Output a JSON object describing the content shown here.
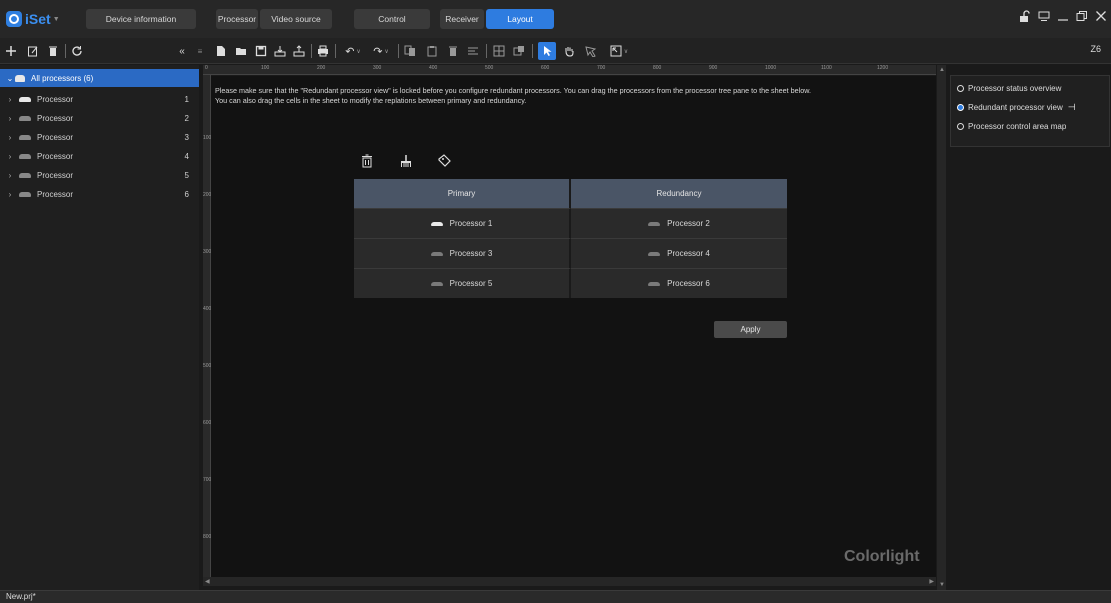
{
  "app": {
    "name": "iSet",
    "tabs": [
      {
        "label": "Device information",
        "active": false
      },
      {
        "label": "Processor",
        "active": false
      },
      {
        "label": "Video source",
        "active": false
      },
      {
        "label": "Control",
        "active": false
      },
      {
        "label": "Receiver",
        "active": false
      },
      {
        "label": "Layout",
        "active": true
      }
    ],
    "window_controls": [
      "unlock-icon",
      "monitor-icon",
      "minimize-icon",
      "restore-icon",
      "close-icon"
    ]
  },
  "toolbar": {
    "zoom": "Z6"
  },
  "tree": {
    "root_label": "All processors (6)",
    "items": [
      {
        "label": "Processor",
        "num": "1",
        "online": true
      },
      {
        "label": "Processor",
        "num": "2",
        "online": false
      },
      {
        "label": "Processor",
        "num": "3",
        "online": false
      },
      {
        "label": "Processor",
        "num": "4",
        "online": false
      },
      {
        "label": "Processor",
        "num": "5",
        "online": false
      },
      {
        "label": "Processor",
        "num": "6",
        "online": false
      }
    ]
  },
  "ruler": {
    "top": [
      "0",
      "100",
      "200",
      "300",
      "400",
      "500",
      "600",
      "700",
      "800",
      "900",
      "1000",
      "1100",
      "1200"
    ],
    "left": [
      "100",
      "200",
      "300",
      "400",
      "500",
      "600",
      "700",
      "800",
      "900"
    ]
  },
  "notice": {
    "line1": "Please make sure that  the \"Redundant processor view\" is locked before you configure redundant processors. You can drag the processors from the processor tree pane to the sheet below.",
    "line2": "You can also drag the cells in the sheet to modify the replations between primary and redundancy."
  },
  "redundancy_table": {
    "headers": [
      "Primary",
      "Redundancy"
    ],
    "rows": [
      {
        "primary": "Processor 1",
        "primary_online": true,
        "redundancy": "Processor 2"
      },
      {
        "primary": "Processor 3",
        "primary_online": false,
        "redundancy": "Processor 4"
      },
      {
        "primary": "Processor 5",
        "primary_online": false,
        "redundancy": "Processor 6"
      }
    ],
    "apply_label": "Apply"
  },
  "view_options": [
    {
      "label": "Processor status overview",
      "selected": false
    },
    {
      "label": "Redundant processor view",
      "selected": true,
      "pinned": true
    },
    {
      "label": "Processor control area map",
      "selected": false
    }
  ],
  "watermark": "Colorlight",
  "status": {
    "file": "New.prj*"
  },
  "colors": {
    "accent": "#2e7ce0",
    "header_bg": "#4a5566"
  }
}
